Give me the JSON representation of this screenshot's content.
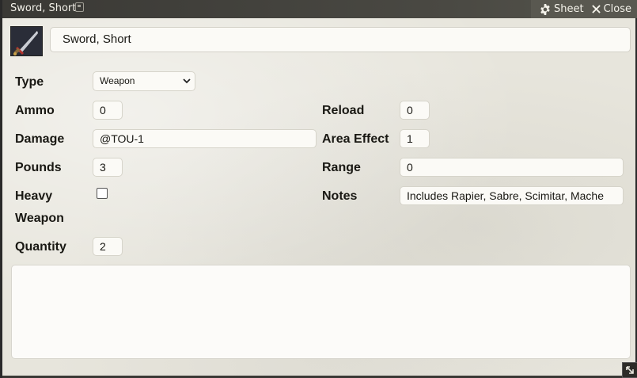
{
  "window": {
    "title": "Sword, Short",
    "actions": {
      "sheet_label": "Sheet",
      "close_label": "Close"
    }
  },
  "item": {
    "name": "Sword, Short",
    "icon": "short-sword-icon"
  },
  "fields": {
    "type": {
      "label": "Type",
      "value": "Weapon"
    },
    "ammo": {
      "label": "Ammo",
      "value": "0"
    },
    "reload": {
      "label": "Reload",
      "value": "0"
    },
    "damage": {
      "label": "Damage",
      "value": "@TOU-1"
    },
    "area_effect": {
      "label": "Area Effect",
      "value": "1"
    },
    "pounds": {
      "label": "Pounds",
      "value": "3"
    },
    "range": {
      "label": "Range",
      "value": "0"
    },
    "heavy_weapon": {
      "label_line1": "Heavy",
      "label_line2": "Weapon",
      "checked": false
    },
    "notes": {
      "label": "Notes",
      "value": "Includes Rapier, Sabre, Scimitar, Mache"
    },
    "quantity": {
      "label": "Quantity",
      "value": "2"
    }
  },
  "description": {
    "value": ""
  },
  "colors": {
    "titlebar": "#3b3a36",
    "panel": "#e7e5dc",
    "input_bg": "#fbfaf6",
    "text": "#191813"
  }
}
